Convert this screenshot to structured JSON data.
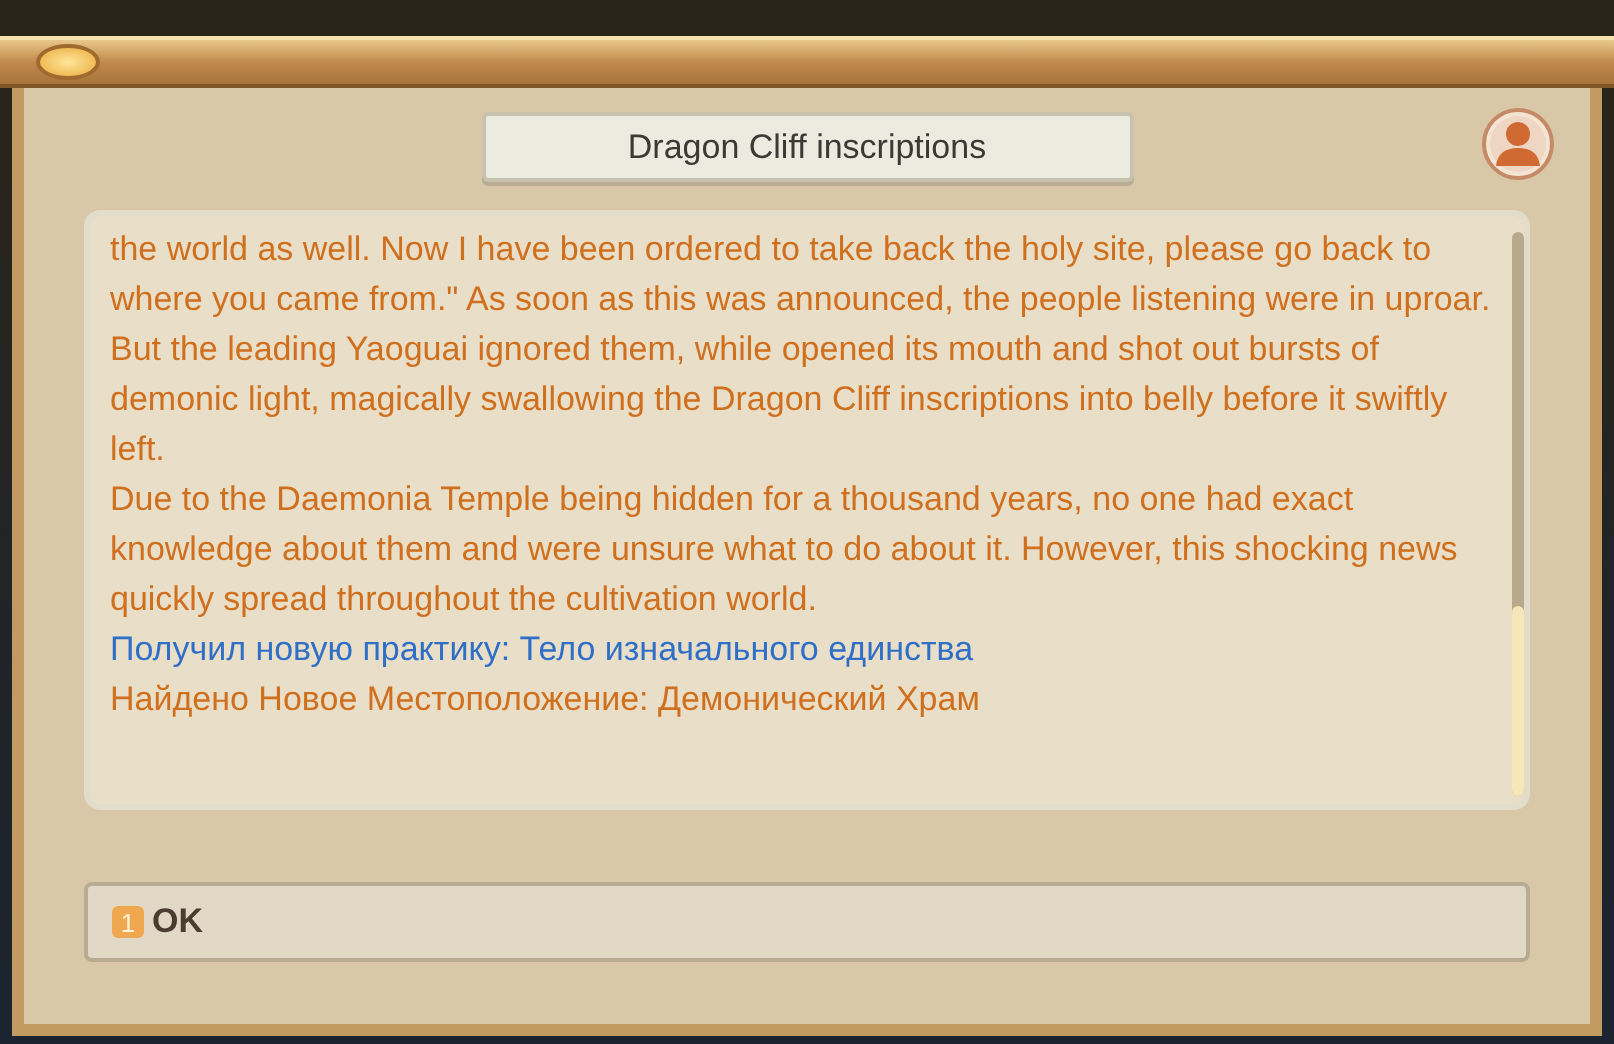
{
  "dialog": {
    "title": "Dragon Cliff inscriptions"
  },
  "messages": [
    {
      "kind": "story",
      "text": "the world as well. Now I have been ordered to take back the holy site, please go back to where you came from.\" As soon as this was announced, the people listening were in uproar. But the leading Yaoguai ignored them, while opened its mouth and shot out bursts of demonic light, magically swallowing the Dragon Cliff  inscriptions into belly before it swiftly left."
    },
    {
      "kind": "story",
      "text": "Due to the Daemonia Temple being hidden for a thousand years, no one had exact  knowledge about them and were unsure what to do about it. However, this shocking news quickly spread throughout the cultivation world."
    },
    {
      "kind": "reward",
      "text": "Получил новую практику: Тело изначального единства"
    },
    {
      "kind": "story",
      "text": "Найдено Новое Местоположение: Демонический Храм"
    }
  ],
  "ok_button": {
    "hotkey": "1",
    "label": "OK"
  }
}
